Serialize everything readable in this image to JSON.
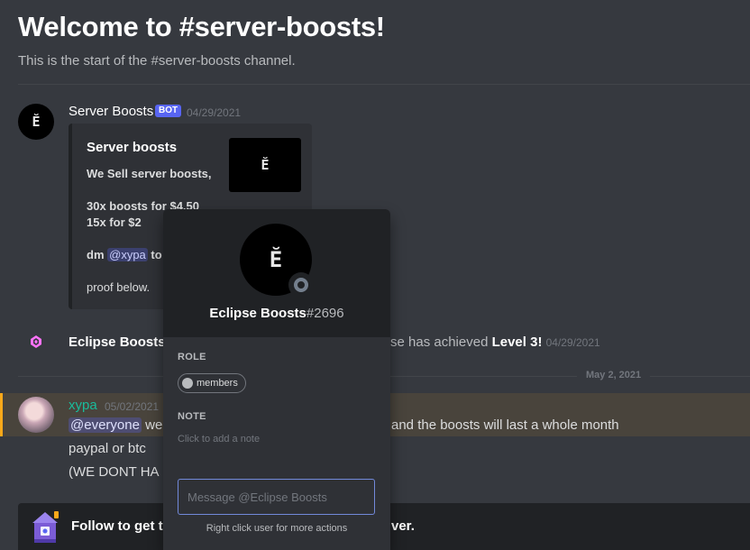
{
  "welcome": {
    "title": "Welcome to #server-boosts!",
    "subtitle": "This is the start of the #server-boosts channel."
  },
  "message1": {
    "author": "Server Boosts",
    "bot_tag": "BOT",
    "timestamp": "04/29/2021",
    "embed": {
      "title": "Server boosts",
      "line1": "We Sell server boosts,",
      "line2": "30x boosts for $4.50",
      "line3": "15x for $2",
      "dm_prefix": "dm",
      "dm_mention": "@xypa",
      "dm_suffix": "to p",
      "proof": "proof below."
    }
  },
  "system_message": {
    "author": "Eclipse Boosts",
    "prefix": "j",
    "text_after": "se has achieved",
    "level": "Level 3!",
    "timestamp": "04/29/2021"
  },
  "date_divider": "May 2, 2021",
  "message2": {
    "author": "xypa",
    "timestamp": "05/02/2021",
    "mention": "@everyone",
    "line1_prefix": "we h",
    "line1_suffix": "and the boosts will last a whole month",
    "line2": "paypal or btc",
    "line3": "(WE DONT HA"
  },
  "follow_bar": {
    "text_prefix": "Follow to get th",
    "text_suffix": "ver."
  },
  "popout": {
    "username": "Eclipse Boosts",
    "discriminator": "#2696",
    "role_label": "ROLE",
    "role_name": "members",
    "note_label": "NOTE",
    "note_placeholder": "Click to add a note",
    "message_placeholder": "Message @Eclipse Boosts",
    "footer": "Right click user for more actions"
  },
  "icons": {
    "avatar_logo": "Ĕ",
    "boost": "server-boost-gem-icon"
  },
  "colors": {
    "background": "#36393f",
    "bot_tag": "#5865f2",
    "highlight_border": "#faa81a",
    "xypa_name": "#1abc9c",
    "boost_gem": "#ff73fa"
  }
}
